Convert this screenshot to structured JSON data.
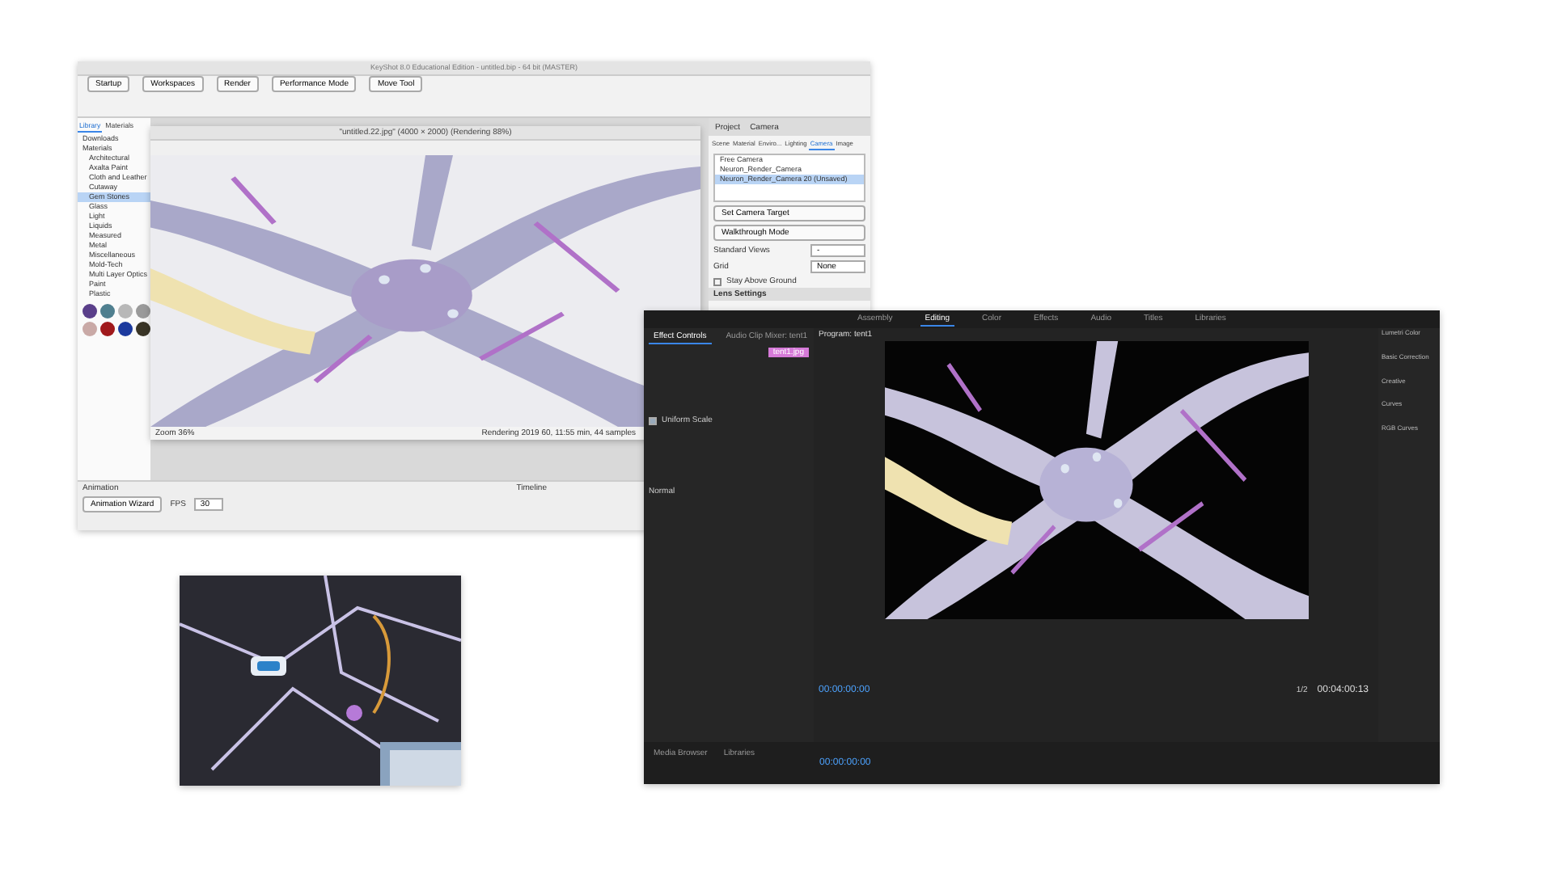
{
  "keyshot": {
    "title": "KeyShot 8.0 Educational Edition - untitled.bip - 64 bit (MASTER)",
    "toolbar": [
      {
        "label": "Startup"
      },
      {
        "label": "Workspaces"
      },
      {
        "label": "Render"
      },
      {
        "label": "Performance Mode"
      },
      {
        "label": "Move Tool"
      }
    ],
    "library": {
      "tabs": [
        {
          "label": "Library",
          "selected": true
        },
        {
          "label": "Materials",
          "selected": false
        }
      ],
      "items": [
        {
          "label": "Downloads",
          "selected": false
        },
        {
          "label": "Materials",
          "selected": false,
          "children": [
            {
              "label": "Architectural",
              "selected": false
            },
            {
              "label": "Axalta Paint",
              "selected": false
            },
            {
              "label": "Cloth and Leather",
              "selected": false
            },
            {
              "label": "Cutaway",
              "selected": false
            },
            {
              "label": "Gem Stones",
              "selected": true
            },
            {
              "label": "Glass",
              "selected": false
            },
            {
              "label": "Light",
              "selected": false
            },
            {
              "label": "Liquids",
              "selected": false
            },
            {
              "label": "Measured",
              "selected": false
            },
            {
              "label": "Metal",
              "selected": false
            },
            {
              "label": "Miscellaneous",
              "selected": false
            },
            {
              "label": "Mold-Tech",
              "selected": false
            },
            {
              "label": "Multi Layer Optics",
              "selected": false
            },
            {
              "label": "Paint",
              "selected": false
            },
            {
              "label": "Plastic",
              "selected": false
            }
          ]
        }
      ],
      "swatches": [
        {
          "color": "#5a3f8a"
        },
        {
          "color": "#4f7f8f"
        },
        {
          "color": "#b8b8b8"
        },
        {
          "color": "#9a9a9a"
        },
        {
          "color": "#c9a9a6"
        },
        {
          "color": "#a0191c"
        },
        {
          "color": "#1c3a9e"
        },
        {
          "color": "#3a3526"
        }
      ]
    },
    "render_window": {
      "title": "\"untitled.22.jpg\" (4000 × 2000) (Rendering 88%)",
      "zoom": "Zoom 36%",
      "status": "Rendering 2019 60, 11:55 min, 44 samples"
    },
    "project": {
      "title": "Project",
      "subtitle": "Camera",
      "tabs": [
        {
          "label": "Scene",
          "selected": false
        },
        {
          "label": "Material",
          "selected": false
        },
        {
          "label": "Enviro...",
          "selected": false
        },
        {
          "label": "Lighting",
          "selected": false
        },
        {
          "label": "Camera",
          "selected": true
        },
        {
          "label": "Image",
          "selected": false
        }
      ],
      "cameras": [
        {
          "label": "Free Camera",
          "selected": false
        },
        {
          "label": "Neuron_Render_Camera",
          "selected": false
        },
        {
          "label": "Neuron_Render_Camera 20 (Unsaved)",
          "selected": true
        }
      ],
      "buttons": [
        "Set Camera Target",
        "Walkthrough Mode"
      ],
      "fields": [
        {
          "label": "Standard Views",
          "value": "-"
        },
        {
          "label": "Grid",
          "value": "None"
        }
      ],
      "stay_above_ground": {
        "label": "Stay Above Ground",
        "checked": false
      },
      "section": "Lens Settings"
    },
    "animation": {
      "title": "Animation",
      "timeline": "Timeline",
      "wizard": "Animation Wizard",
      "fps_label": "FPS",
      "fps": "30"
    }
  },
  "premiere": {
    "workspaces": [
      {
        "label": "Assembly",
        "selected": false
      },
      {
        "label": "Editing",
        "selected": true
      },
      {
        "label": "Color",
        "selected": false
      },
      {
        "label": "Effects",
        "selected": false
      },
      {
        "label": "Audio",
        "selected": false
      },
      {
        "label": "Titles",
        "selected": false
      },
      {
        "label": "Libraries",
        "selected": false
      }
    ],
    "panels": [
      {
        "label": "Effect Controls",
        "selected": true
      },
      {
        "label": "Audio Clip Mixer: tent1",
        "selected": false
      }
    ],
    "clip": "tent1.jpg",
    "uniform_scale": {
      "label": "Uniform Scale",
      "checked": true
    },
    "blend": "Normal",
    "program": "Program: tent1",
    "timecode": "00:00:00:00",
    "fit": "1/2",
    "duration": "00:04:00:13",
    "bottom_tabs": [
      "Media Browser",
      "Libraries"
    ],
    "sequence_time": "00:00:00:00",
    "lumetri": [
      "Lumetri Color",
      "Basic Correction",
      "Creative",
      "Curves",
      "RGB Curves"
    ]
  }
}
